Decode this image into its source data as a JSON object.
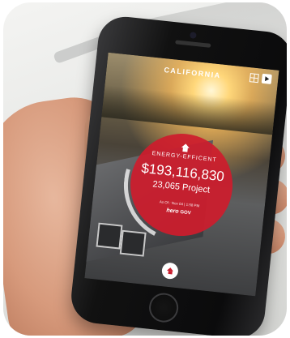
{
  "screen": {
    "location": "CALIFORNIA",
    "badge_label": "ENERGY-EFFICENT",
    "amount": "$193,116,830",
    "projects": "23,065 Project",
    "date_line": "As Of : Nov 04 | 1:58 PM",
    "brand_name": "hero",
    "brand_suffix": "GOV"
  },
  "colors": {
    "accent": "#ce1c2d",
    "phone": "#0b0b0c"
  },
  "icons": [
    "grid-icon",
    "play-icon",
    "house-icon",
    "home-icon"
  ]
}
